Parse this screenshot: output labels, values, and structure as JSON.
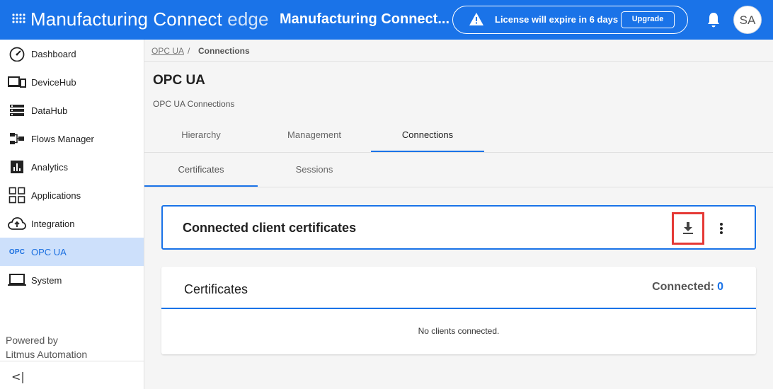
{
  "header": {
    "app_title": "Manufacturing Connect",
    "app_title_suffix": "edge",
    "device_title": "Manufacturing Connect...",
    "license_text": "License will expire in 6 days",
    "upgrade_label": "Upgrade",
    "avatar_initials": "SA",
    "brand_color": "#1a73e8"
  },
  "sidebar": {
    "items": [
      {
        "label": "Dashboard",
        "icon": "dashboard-gauge-icon"
      },
      {
        "label": "DeviceHub",
        "icon": "devices-icon"
      },
      {
        "label": "DataHub",
        "icon": "storage-icon"
      },
      {
        "label": "Flows Manager",
        "icon": "flows-icon"
      },
      {
        "label": "Analytics",
        "icon": "analytics-icon"
      },
      {
        "label": "Applications",
        "icon": "applications-grid-icon"
      },
      {
        "label": "Integration",
        "icon": "cloud-upload-icon"
      },
      {
        "label": "OPC UA",
        "icon_text": "OPC",
        "active": true
      },
      {
        "label": "System",
        "icon": "laptop-icon"
      }
    ],
    "powered_line1": "Powered by",
    "powered_line2": "Litmus Automation",
    "collapse_glyph": "<|"
  },
  "breadcrumb": {
    "parent": "OPC UA",
    "separator": "/",
    "current": "Connections"
  },
  "page": {
    "title": "OPC UA",
    "subtitle": "OPC UA Connections"
  },
  "tabs": [
    {
      "label": "Hierarchy",
      "active": false
    },
    {
      "label": "Management",
      "active": false
    },
    {
      "label": "Connections",
      "active": true
    }
  ],
  "subtabs": [
    {
      "label": "Certificates",
      "active": true
    },
    {
      "label": "Sessions",
      "active": false
    }
  ],
  "connected_card": {
    "title": "Connected client certificates"
  },
  "certificates_card": {
    "title": "Certificates",
    "connected_label": "Connected:",
    "connected_count": "0",
    "empty_text": "No clients connected."
  }
}
